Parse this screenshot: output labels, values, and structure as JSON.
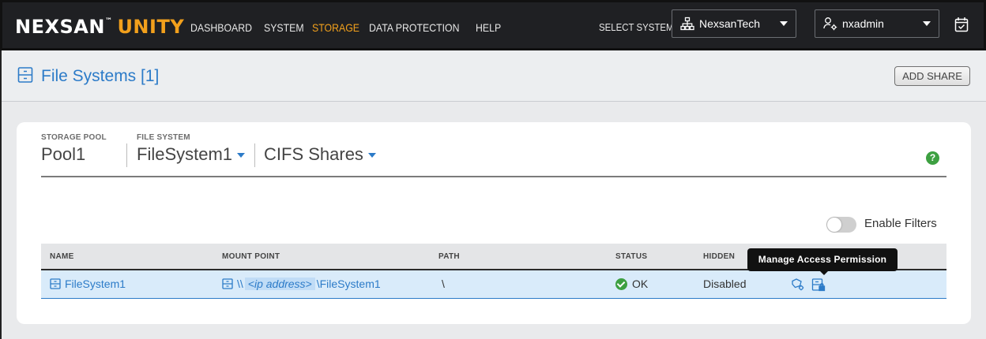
{
  "app": {
    "brand": "NEXSAN",
    "trademark": "™",
    "product": "UNITY"
  },
  "nav": {
    "items": [
      "DASHBOARD",
      "SYSTEM",
      "STORAGE",
      "DATA PROTECTION",
      "HELP"
    ],
    "active": "STORAGE"
  },
  "system_select": {
    "label": "SELECT SYSTEM:",
    "value": "NexsanTech"
  },
  "user_menu": {
    "value": "nxadmin"
  },
  "page": {
    "title": "File Systems [1]",
    "add_share_label": "ADD SHARE"
  },
  "breadcrumb": {
    "storage_pool_label": "STORAGE POOL",
    "storage_pool_value": "Pool1",
    "file_system_label": "FILE SYSTEM",
    "file_system_value": "FileSystem1",
    "view_value": "CIFS Shares"
  },
  "filters": {
    "label": "Enable Filters",
    "enabled": false
  },
  "table": {
    "columns": [
      "NAME",
      "MOUNT POINT",
      "PATH",
      "STATUS",
      "HIDDEN"
    ],
    "rows": [
      {
        "name": "FileSystem1",
        "mount_prefix": "\\\\",
        "mount_ip": "<ip address>",
        "mount_suffix": "\\FileSystem1",
        "path": "\\",
        "status": "OK",
        "hidden": "Disabled"
      }
    ]
  },
  "tooltip": {
    "text": "Manage Access Permission"
  },
  "colors": {
    "accent": "#2c7bc8",
    "brand_orange": "#f2a01c",
    "ok_green": "#3da041",
    "topbar": "#1f2023"
  }
}
